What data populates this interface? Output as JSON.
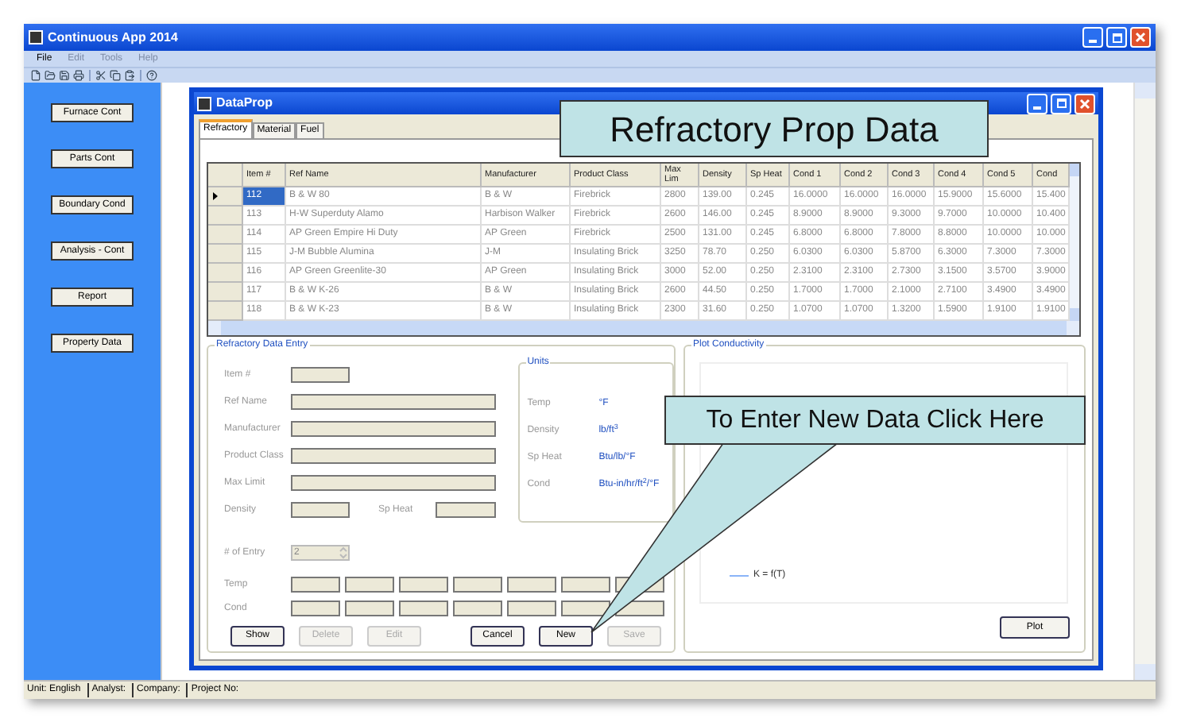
{
  "window": {
    "title": "Continuous App 2014"
  },
  "menu": [
    {
      "label": "File",
      "disabled": false
    },
    {
      "label": "Edit",
      "disabled": true
    },
    {
      "label": "Tools",
      "disabled": true
    },
    {
      "label": "Help",
      "disabled": true
    }
  ],
  "sidebar": {
    "buttons": [
      "Furnace Cont",
      "Parts Cont",
      "Boundary Cond",
      "Analysis - Cont",
      "Report",
      "Property Data"
    ]
  },
  "dataprop_window": {
    "title": "DataProp",
    "tabs": [
      {
        "label": "Refractory",
        "selected": true
      },
      {
        "label": "Material",
        "selected": false
      },
      {
        "label": "Fuel",
        "selected": false
      }
    ],
    "table": {
      "columns": [
        "Item #",
        "Ref Name",
        "Manufacturer",
        "Product Class",
        "Max Lim",
        "Density",
        "Sp Heat",
        "Cond 1",
        "Cond 2",
        "Cond 3",
        "Cond 4",
        "Cond 5",
        "Cond"
      ],
      "rows": [
        {
          "selected": true,
          "cells": [
            "112",
            "B & W 80",
            "B & W",
            "Firebrick",
            "2800",
            "139.00",
            "0.245",
            "16.0000",
            "16.0000",
            "16.0000",
            "15.9000",
            "15.6000",
            "15.400"
          ]
        },
        {
          "selected": false,
          "cells": [
            "113",
            "H-W Superduty Alamo",
            "Harbison Walker",
            "Firebrick",
            "2600",
            "146.00",
            "0.245",
            "8.9000",
            "8.9000",
            "9.3000",
            "9.7000",
            "10.0000",
            "10.400"
          ]
        },
        {
          "selected": false,
          "cells": [
            "114",
            "AP Green Empire Hi Duty",
            "AP Green",
            "Firebrick",
            "2500",
            "131.00",
            "0.245",
            "6.8000",
            "6.8000",
            "7.8000",
            "8.8000",
            "10.0000",
            "10.000"
          ]
        },
        {
          "selected": false,
          "cells": [
            "115",
            "J-M Bubble Alumina",
            "J-M",
            "Insulating Brick",
            "3250",
            "78.70",
            "0.250",
            "6.0300",
            "6.0300",
            "5.8700",
            "6.3000",
            "7.3000",
            "7.3000"
          ]
        },
        {
          "selected": false,
          "cells": [
            "116",
            "AP Green Greenlite-30",
            "AP Green",
            "Insulating Brick",
            "3000",
            "52.00",
            "0.250",
            "2.3100",
            "2.3100",
            "2.7300",
            "3.1500",
            "3.5700",
            "3.9000"
          ]
        },
        {
          "selected": false,
          "cells": [
            "117",
            "B & W K-26",
            "B & W",
            "Insulating Brick",
            "2600",
            "44.50",
            "0.250",
            "1.7000",
            "1.7000",
            "2.1000",
            "2.7100",
            "3.4900",
            "3.4900"
          ]
        },
        {
          "selected": false,
          "cells": [
            "118",
            "B & W K-23",
            "B & W",
            "Insulating Brick",
            "2300",
            "31.60",
            "0.250",
            "1.0700",
            "1.0700",
            "1.3200",
            "1.5900",
            "1.9100",
            "1.9100"
          ]
        }
      ]
    },
    "data_entry": {
      "title": "Refractory Data Entry",
      "fields": [
        {
          "label": "Item #",
          "kind": "short"
        },
        {
          "label": "Ref Name",
          "kind": "long"
        },
        {
          "label": "Manufacturer",
          "kind": "long"
        },
        {
          "label": "Product Class",
          "kind": "long"
        },
        {
          "label": "Max Limit",
          "kind": "long"
        },
        {
          "label": "Density",
          "kind": "pair",
          "pair_label": "Sp Heat"
        }
      ],
      "entry_count": {
        "label": "# of Entry",
        "value": "2",
        "disabled": true
      },
      "temp_label": "Temp",
      "cond_label": "Cond",
      "units": {
        "title": "Units",
        "rows": [
          {
            "label": "Temp",
            "value": "°F"
          },
          {
            "label": "Density",
            "value": "lb/ft$^{3}$"
          },
          {
            "label": "Sp Heat",
            "value": "Btu/lb/°F"
          },
          {
            "label": "Cond",
            "value": "Btu-in/hr/ft$^{2}$/°F"
          }
        ]
      },
      "buttons": [
        {
          "label": "Show",
          "disabled": false
        },
        {
          "label": "Delete",
          "disabled": true
        },
        {
          "label": "Edit",
          "disabled": true
        },
        {
          "label": "Cancel",
          "disabled": false
        },
        {
          "label": "New",
          "disabled": false
        },
        {
          "label": "Save",
          "disabled": true
        }
      ]
    },
    "plot": {
      "title": "Plot Conductivity",
      "legend": "K = f(T)",
      "button": "Plot"
    }
  },
  "status_bar": [
    "Unit: English",
    "Analyst:",
    "Company:",
    "Project No:"
  ],
  "callouts": [
    {
      "text": "Refractory Prop Data"
    },
    {
      "text": "To Enter New Data Click Here"
    }
  ]
}
